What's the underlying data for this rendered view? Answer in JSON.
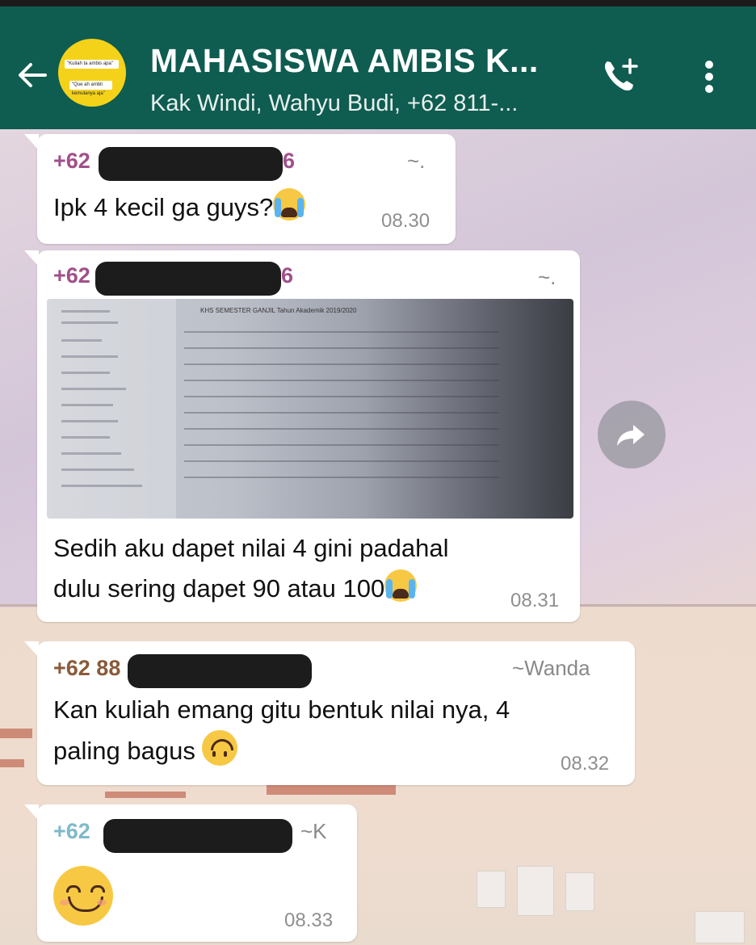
{
  "header": {
    "title": "MAHASISWA AMBIS K...",
    "subtitle": "Kak Windi, Wahyu Budi, +62 811-...",
    "avatar_line1": "\"Kuliah ta ambis apa\"",
    "avatar_line2": "\"Que ah ambil kemulanya aja\""
  },
  "messages": [
    {
      "sender": "+62",
      "sender_suffix": "6",
      "sender_color": "#a0508a",
      "alias": "~.",
      "text": "Ipk 4 kecil ga guys?",
      "emoji": "loudly-crying-face",
      "time": "08.30"
    },
    {
      "sender": "+62",
      "sender_suffix": "6",
      "sender_color": "#a0508a",
      "alias": "~.",
      "attachment_caption": "KHS SEMESTER GANJIL Tahun Akademik 2019/2020",
      "text_line1": "Sedih aku dapet nilai 4 gini padahal",
      "text_line2": "dulu sering dapet 90 atau 100",
      "emoji": "loudly-crying-face",
      "time": "08.31"
    },
    {
      "sender": "+62 88",
      "sender_color": "#8a5a3a",
      "alias": "~Wanda",
      "text_line1": "Kan kuliah emang gitu bentuk nilai nya, 4",
      "text_line2": "paling bagus",
      "emoji": "upside-down-face",
      "time": "08.32"
    },
    {
      "sender": "+62",
      "sender_color": "#7fb9c9",
      "alias": "~K",
      "emoji": "smiling-face-with-smiling-eyes",
      "time": "08.33"
    }
  ],
  "colors": {
    "header_bg": "#0f5c50",
    "bubble_bg": "#ffffff"
  },
  "icons": [
    "back-arrow-icon",
    "add-call-icon",
    "more-vert-icon",
    "forward-icon"
  ]
}
